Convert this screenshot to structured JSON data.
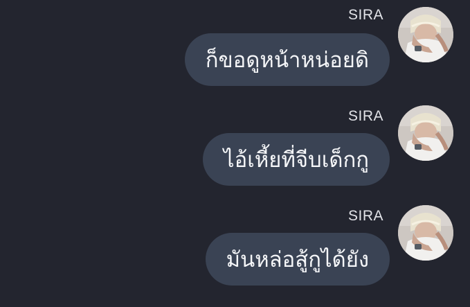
{
  "messages": [
    {
      "sender": "SIRA",
      "text": "ก็ขอดูหน้าหน่อยดิ",
      "avatar_icon": "user-avatar"
    },
    {
      "sender": "SIRA",
      "text": "ไอ้เหี้ยที่จีบเด็กกู",
      "avatar_icon": "user-avatar"
    },
    {
      "sender": "SIRA",
      "text": "มันหล่อสู้กูได้ยัง",
      "avatar_icon": "user-avatar"
    }
  ],
  "colors": {
    "background": "#23252f",
    "bubble": "#3a4354",
    "text": "#f5f6f8",
    "sender": "#e2e3e8"
  }
}
